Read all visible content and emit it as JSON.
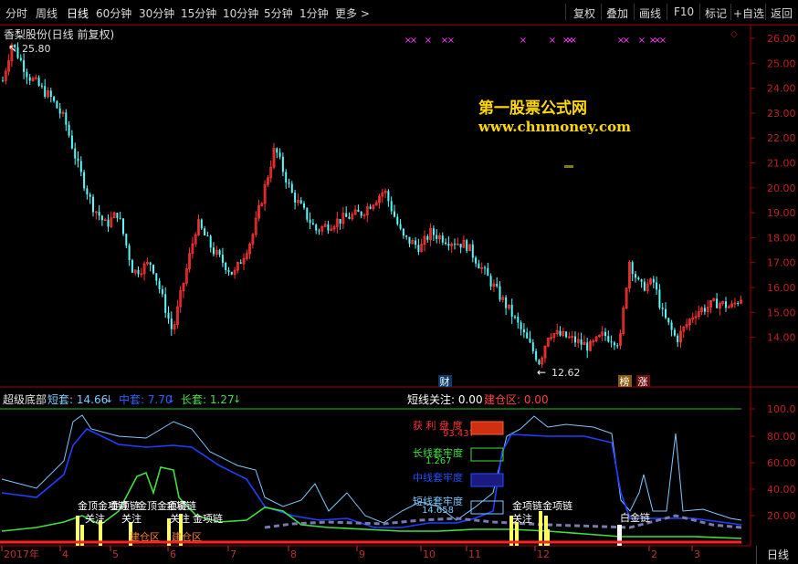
{
  "toolbar": {
    "left_items": [
      "分时",
      "周线",
      "日线",
      "60分钟",
      "30分钟",
      "15分钟",
      "10分钟",
      "5分钟",
      "1分钟",
      "更多 >"
    ],
    "active_index": 2,
    "right_items": [
      "复权",
      "叠加",
      "画线",
      "F10",
      "标记",
      "+自选",
      "返回"
    ]
  },
  "main_chart": {
    "title": "香梨股份(日线 前复权)",
    "high_label": "25.80",
    "low_label": "12.62",
    "y_labels": [
      "26.00",
      "25.00",
      "24.00",
      "23.00",
      "22.00",
      "21.00",
      "20.00",
      "19.00",
      "18.00",
      "17.00",
      "16.00",
      "15.00",
      "14.00"
    ],
    "watermark_line1": "第一股票公式网",
    "watermark_line2": "www.chnmoney.com",
    "event_marks": [
      "财",
      "榜",
      "涨"
    ],
    "colors": {
      "up": "#ff3232",
      "down": "#54fcfc",
      "background": "#000000",
      "grid": "#800000"
    }
  },
  "indicator": {
    "name": "超级底部",
    "short_label": "短套: 14.66",
    "mid_label": "中套: 7.70",
    "long_label": "长套: 1.27",
    "watch_label": "短线关注: 0.00",
    "build_label": "建仓区: 0.00",
    "y_labels": [
      "100.0",
      "80.00",
      "60.00",
      "40.00",
      "20.00"
    ],
    "legend": {
      "profit": "获 利 盘 度",
      "profit_val": "93.437",
      "long": "长线套牢度",
      "long_val": "1.267",
      "mid": "中线套牢度",
      "short": "短线套牢度",
      "short_val": "14.658"
    },
    "annotations": {
      "gold_top": "金顶",
      "gold_chain": "金项链",
      "watch": "关注",
      "build_zone": "建仓区",
      "white_chain": "白金链"
    }
  },
  "x_axis": {
    "labels": [
      "2017年",
      "4",
      "5",
      "6",
      "7",
      "8",
      "9",
      "10",
      "11",
      "12",
      "2",
      "3"
    ]
  },
  "status": {
    "period_tab": "日线"
  }
}
